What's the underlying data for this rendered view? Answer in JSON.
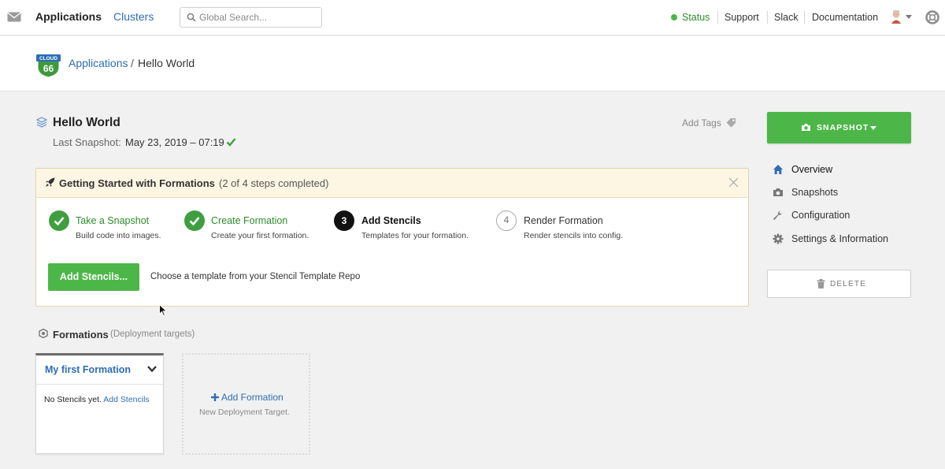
{
  "nav": {
    "applications": "Applications",
    "clusters": "Clusters",
    "search_placeholder": "Global Search...",
    "status": "Status",
    "support": "Support",
    "slack": "Slack",
    "documentation": "Documentation"
  },
  "logo": {
    "line1": "CLOUD",
    "line2": "66"
  },
  "breadcrumb": {
    "parent": "Applications",
    "separator": "/",
    "current": "Hello World"
  },
  "app": {
    "title": "Hello World",
    "snapshot_label": "Last Snapshot:",
    "snapshot_value": "May 23, 2019 – 07:19",
    "add_tags": "Add Tags"
  },
  "getting_started": {
    "title": "Getting Started with Formations",
    "progress": "(2 of 4 steps completed)",
    "steps": [
      {
        "number": "1",
        "title": "Take a Snapshot",
        "desc": "Build code into images.",
        "state": "done"
      },
      {
        "number": "2",
        "title": "Create Formation",
        "desc": "Create your first formation.",
        "state": "done"
      },
      {
        "number": "3",
        "title": "Add Stencils",
        "desc": "Templates for your formation.",
        "state": "active"
      },
      {
        "number": "4",
        "title": "Render Formation",
        "desc": "Render stencils into config.",
        "state": "todo"
      }
    ],
    "button": "Add Stencils...",
    "hint": "Choose a template from your Stencil Template Repo"
  },
  "sidebar": {
    "snapshot_button": "SNAPSHOT",
    "items": [
      {
        "label": "Overview",
        "icon": "home-icon"
      },
      {
        "label": "Snapshots",
        "icon": "camera-icon"
      },
      {
        "label": "Configuration",
        "icon": "wrench-icon"
      },
      {
        "label": "Settings & Information",
        "icon": "gear-icon"
      }
    ],
    "delete_button": "DELETE"
  },
  "formations": {
    "title": "Formations",
    "subtitle": "(Deployment targets)",
    "card": {
      "title": "My first Formation",
      "body": "No Stencils yet.",
      "link": "Add Stencils"
    },
    "new_card": {
      "title": "Add Formation",
      "subtitle": "New Deployment Target."
    }
  },
  "colors": {
    "accent_green": "#4cb748",
    "link_blue": "#2e6db4",
    "banner_bg": "#fdf6e3"
  }
}
